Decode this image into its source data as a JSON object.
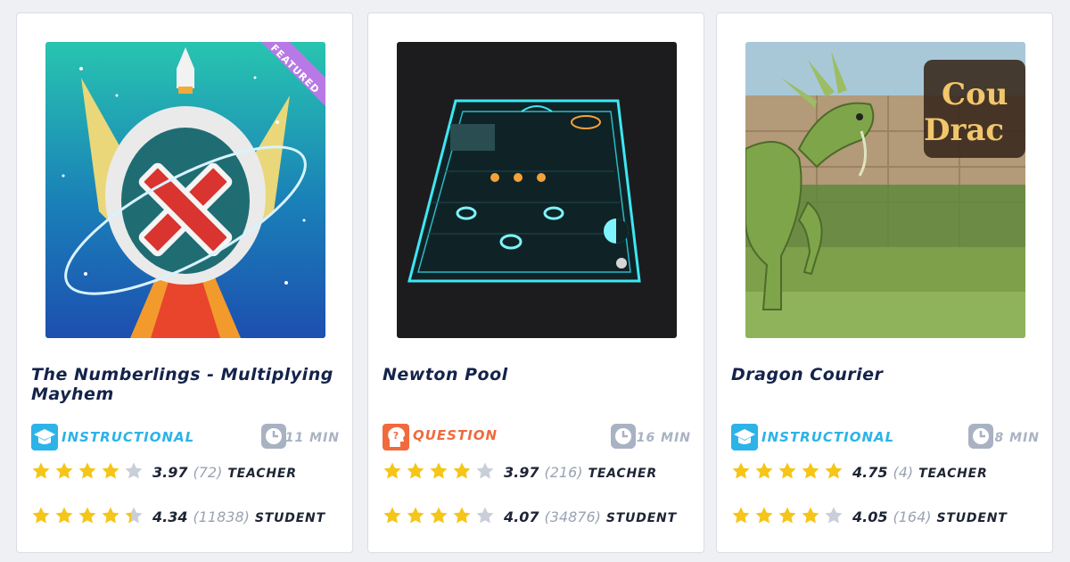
{
  "colors": {
    "star_filled": "#f5c518",
    "star_empty": "#c9ced8",
    "instructional": "#2cb3e8",
    "question": "#f06a3c",
    "clock": "#a9b2c2",
    "title": "#14234a",
    "featured_ribbon": "#b879e6"
  },
  "cards": [
    {
      "title": "The Numberlings - Multiplying Mayhem",
      "badge": "FEATURED",
      "type": {
        "label": "INSTRUCTIONAL",
        "icon": "graduation-cap-icon"
      },
      "duration": "11 MIN",
      "teacher": {
        "avg": "3.97",
        "count": "(72)",
        "label": "TEACHER",
        "stars": 4
      },
      "student": {
        "avg": "4.34",
        "count": "(11838)",
        "label": "STUDENT",
        "stars": 4.34
      }
    },
    {
      "title": "Newton Pool",
      "type": {
        "label": "QUESTION",
        "icon": "question-head-icon"
      },
      "duration": "16 MIN",
      "teacher": {
        "avg": "3.97",
        "count": "(216)",
        "label": "TEACHER",
        "stars": 4
      },
      "student": {
        "avg": "4.07",
        "count": "(34876)",
        "label": "STUDENT",
        "stars": 4
      }
    },
    {
      "title": "Dragon Courier",
      "type": {
        "label": "INSTRUCTIONAL",
        "icon": "graduation-cap-icon"
      },
      "duration": "8 MIN",
      "teacher": {
        "avg": "4.75",
        "count": "(4)",
        "label": "TEACHER",
        "stars": 5
      },
      "student": {
        "avg": "4.05",
        "count": "(164)",
        "label": "STUDENT",
        "stars": 4
      }
    }
  ]
}
